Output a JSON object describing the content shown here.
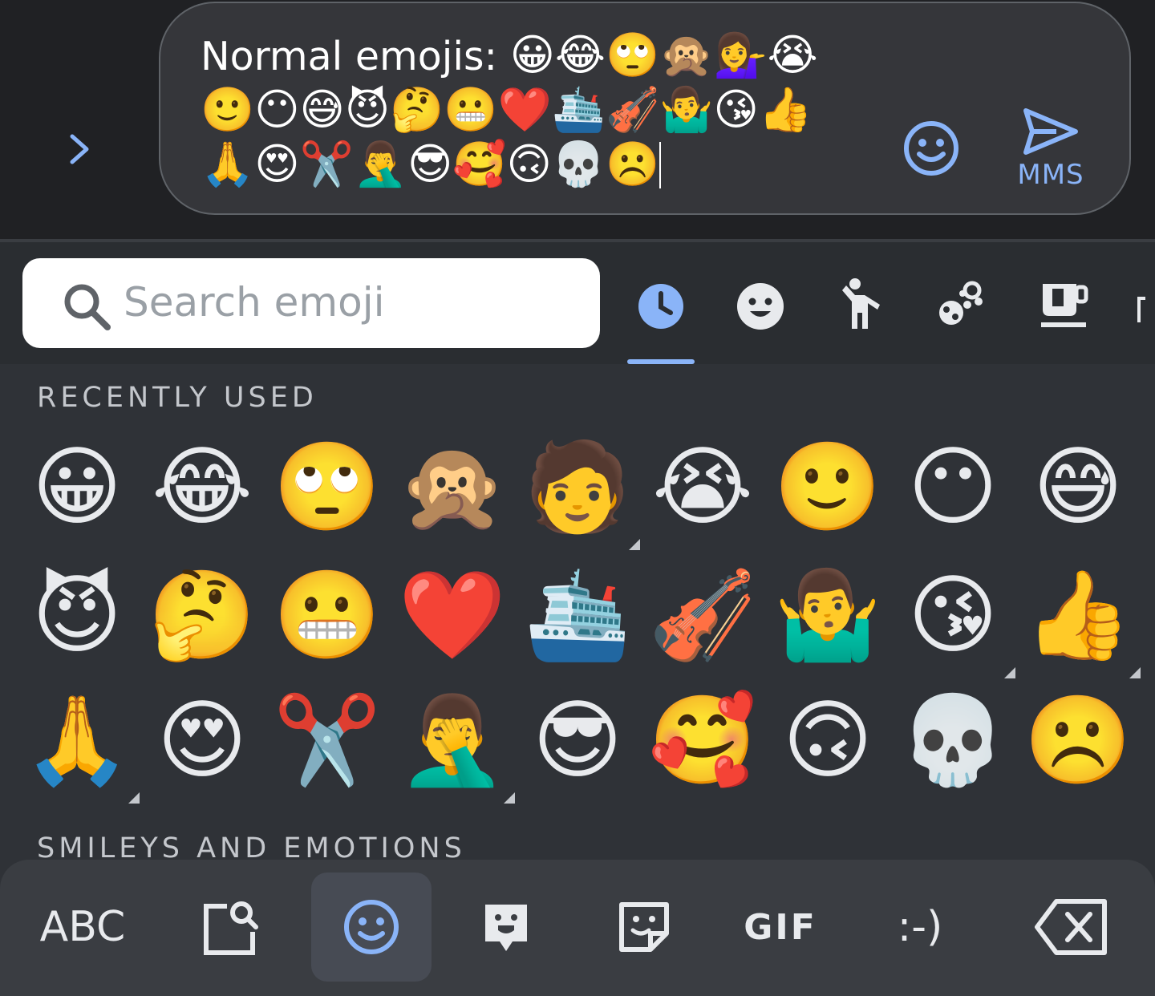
{
  "compose": {
    "message_prefix": "Normal emojis: ",
    "message_emojis": "😀😂🙄🙊💁‍♀️😭🙂😶😅😈🤔😬❤️🛳️🎻🤷‍♂️😘👍🙏😍✂️🤦‍♂️😎🥰🙃💀☹️",
    "send_label": "MMS",
    "icons": {
      "expand": "chevron-right-icon",
      "emoji_toggle": "smiley-icon",
      "send": "send-icon"
    },
    "accent_color": "#8ab4f8"
  },
  "emoji_picker": {
    "search_placeholder": "Search emoji",
    "category_tabs": [
      {
        "name": "recent",
        "icon": "clock-icon",
        "active": true
      },
      {
        "name": "smileys",
        "icon": "smiley-icon",
        "active": false
      },
      {
        "name": "people-activity",
        "icon": "person-walking-icon",
        "active": false
      },
      {
        "name": "nature",
        "icon": "flower-bug-icon",
        "active": false
      },
      {
        "name": "food",
        "icon": "coffee-cup-icon",
        "active": false
      }
    ],
    "sections": [
      {
        "title": "RECENTLY USED",
        "emojis": [
          "😀",
          "😂",
          "🙄",
          "🙊",
          "🧑",
          "😭",
          "🙂",
          "😶",
          "😅",
          "😈",
          "🤔",
          "😬",
          "❤️",
          "🛳️",
          "🎻",
          "🤷‍♂️",
          "😘",
          "👍",
          "🙏",
          "😍",
          "✂️",
          "🤦‍♂️",
          "😎",
          "🥰",
          "🙃",
          "💀",
          "☹️"
        ],
        "variant_marks": [
          4,
          16,
          17,
          18,
          21
        ]
      },
      {
        "title": "SMILEYS AND EMOTIONS",
        "emojis": []
      }
    ]
  },
  "toolbar": {
    "abc_label": "ABC",
    "gif_label": "GIF",
    "emoticon_label": ":-)",
    "buttons": [
      {
        "name": "abc",
        "icon": null
      },
      {
        "name": "emoji-search",
        "icon": "emoji-search-icon"
      },
      {
        "name": "emoji",
        "icon": "smiley-icon",
        "active": true
      },
      {
        "name": "bitmoji",
        "icon": "bitmoji-icon"
      },
      {
        "name": "sticker",
        "icon": "sticker-icon"
      },
      {
        "name": "gif",
        "icon": null
      },
      {
        "name": "emoticon",
        "icon": null
      },
      {
        "name": "backspace",
        "icon": "backspace-icon"
      }
    ]
  }
}
